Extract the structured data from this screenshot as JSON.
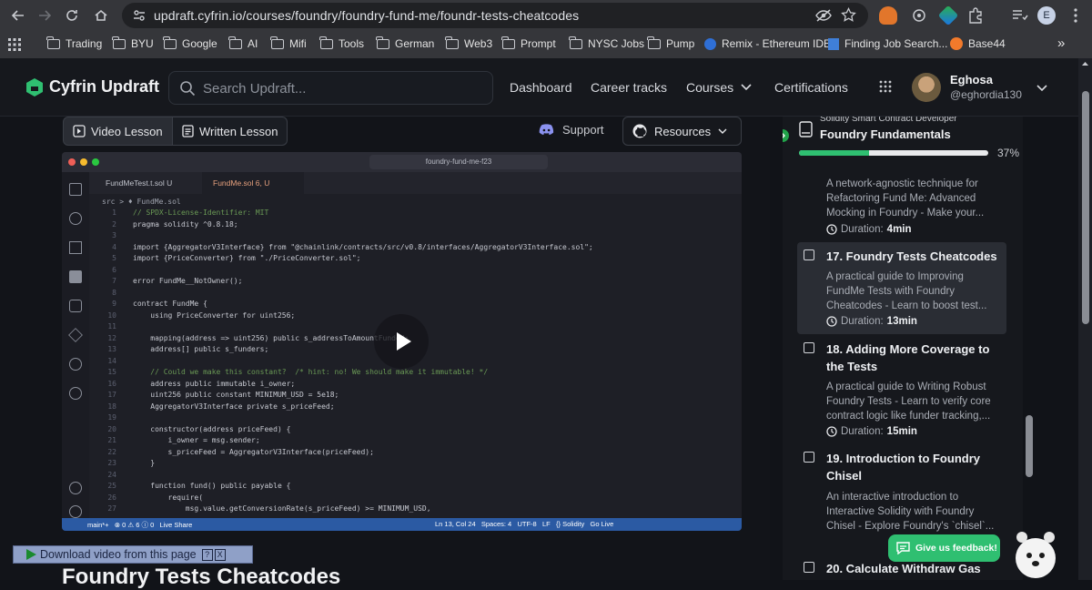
{
  "browser": {
    "url": "updraft.cyfrin.io/courses/foundry/foundry-fund-me/foundr-tests-cheatcodes",
    "profile_initial": "E",
    "bookmarks": [
      "Trading",
      "BYU",
      "Google",
      "AI",
      "Mifi",
      "Tools",
      "German",
      "Web3",
      "Prompt",
      "NYSC Jobs",
      "Pump",
      "Remix - Ethereum IDE",
      "Finding Job Search...",
      "Base44"
    ],
    "overflow": "»"
  },
  "header": {
    "brand": "Cyfrin Updraft",
    "search_placeholder": "Search Updraft...",
    "nav": [
      "Dashboard",
      "Career tracks",
      "Courses",
      "Certifications"
    ],
    "user_name": "Eghosa",
    "user_handle": "@eghordia130"
  },
  "lesson_tabs": {
    "video": "Video Lesson",
    "written": "Written Lesson",
    "support": "Support",
    "resources": "Resources"
  },
  "editor": {
    "search": "foundry-fund-me-f23",
    "tab1": "FundMeTest.t.sol U",
    "tab2": "FundMe.sol 6, U",
    "breadcrumb": "src > ♦ FundMe.sol",
    "lines": [
      "// SPDX-License-Identifier: MIT",
      "pragma solidity ^0.8.18;",
      "",
      "import {AggregatorV3Interface} from \"@chainlink/contracts/src/v0.8/interfaces/AggregatorV3Interface.sol\";",
      "import {PriceConverter} from \"./PriceConverter.sol\";",
      "",
      "error FundMe__NotOwner();",
      "",
      "contract FundMe {",
      "    using PriceConverter for uint256;",
      "",
      "    mapping(address => uint256) public s_addressToAmountFunded;",
      "    address[] public s_funders;",
      "",
      "    // Could we make this constant?  /* hint: no! We should make it immutable! */",
      "    address public immutable i_owner;",
      "    uint256 public constant MINIMUM_USD = 5e18;",
      "    AggregatorV3Interface private s_priceFeed;",
      "",
      "    constructor(address priceFeed) {",
      "        i_owner = msg.sender;",
      "        s_priceFeed = AggregatorV3Interface(priceFeed);",
      "    }",
      "",
      "    function fund() public payable {",
      "        require(",
      "            msg.value.getConversionRate(s_priceFeed) >= MINIMUM_USD,"
    ],
    "status": "main*+   ⊗ 0 ⚠ 6 ⓘ 0   Live Share",
    "status_right": "Ln 13, Col 24   Spaces: 4   UTF-8   LF   {} Solidity   Go Live"
  },
  "download_bar": "Download video from this page",
  "page_heading": "Foundry Tests Cheatcodes",
  "sidebar": {
    "track": "Solidity Smart Contract Developer",
    "course": "Foundry Fundamentals",
    "progress_label": "37%",
    "progress": 0.37,
    "lessons": [
      {
        "title": "",
        "desc": "A network-agnostic technique for Refactoring Fund Me: Advanced Mocking in Foundry - Make your...",
        "duration": "4min"
      },
      {
        "title": "17. Foundry Tests Cheatcodes",
        "desc": "A practical guide to Improving FundMe Tests with Foundry Cheatcodes - Learn to boost test...",
        "duration": "13min"
      },
      {
        "title": "18. Adding More Coverage to the Tests",
        "desc": "A practical guide to Writing Robust Foundry Tests - Learn to verify core contract logic like funder tracking,...",
        "duration": "15min"
      },
      {
        "title": "19. Introduction to Foundry Chisel",
        "desc": "An interactive introduction to Interactive Solidity with Foundry Chisel - Explore Foundry's `chisel`...",
        "duration": ""
      },
      {
        "title": "20. Calculate Withdraw Gas",
        "desc": "",
        "duration": ""
      }
    ],
    "duration_label": "Duration:"
  },
  "feedback": "Give us feedback!"
}
